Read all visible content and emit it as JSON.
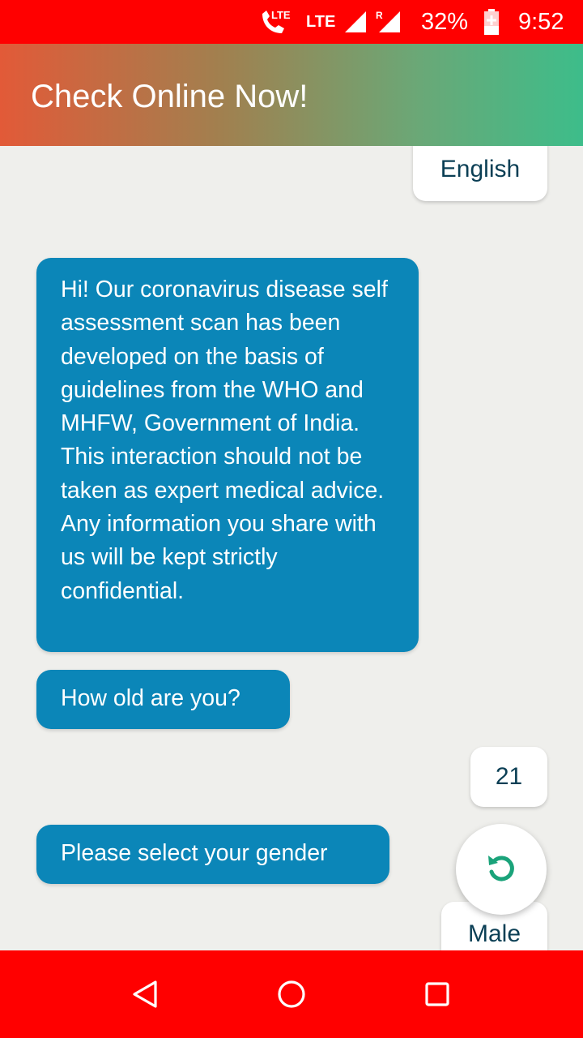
{
  "status_bar": {
    "lte_call": "LTE",
    "network": "LTE",
    "roaming": "R",
    "battery": "32%",
    "time": "9:52"
  },
  "app_bar": {
    "title": "Check Online Now!"
  },
  "chat": {
    "language_reply": "English",
    "intro_message": "Hi! Our coronavirus disease self assessment scan has been developed on the basis of guidelines from the WHO and MHFW, Government of India. This interaction should not be taken as expert medical advice. Any information you share with us will be kept strictly confidential.",
    "age_question": "How old are you?",
    "age_reply": "21",
    "gender_question": "Please select your gender",
    "gender_option": "Male"
  },
  "icons": {
    "restart": "restart-icon",
    "back": "back-icon",
    "home": "home-icon",
    "recents": "recents-icon"
  },
  "colors": {
    "status_bar": "#ff0000",
    "bot_bubble": "#0b86b8",
    "user_text": "#0b3f55",
    "accent_green": "#1aa37a",
    "background": "#efefec"
  }
}
